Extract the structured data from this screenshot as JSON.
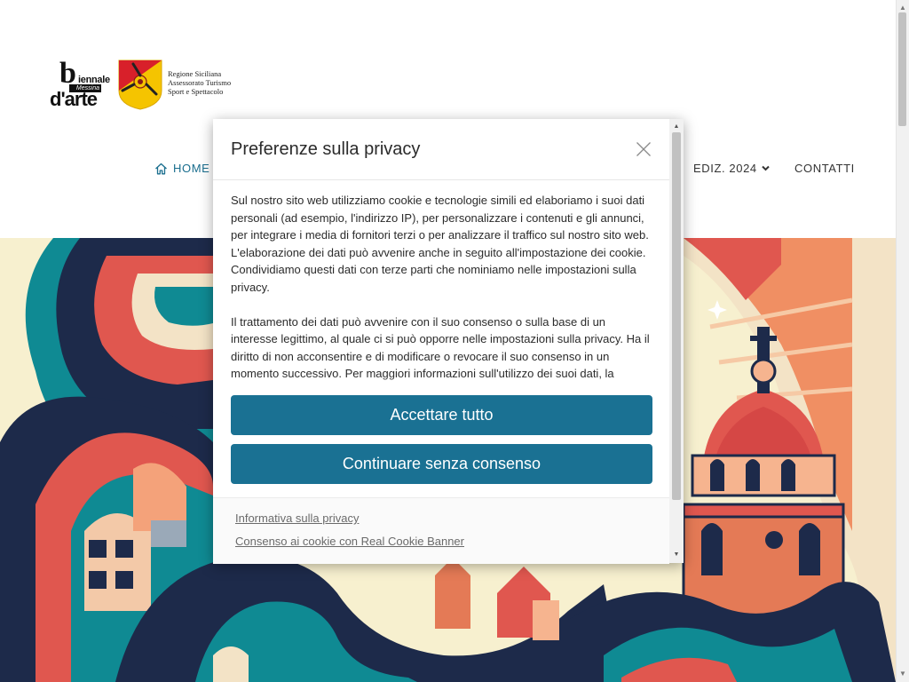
{
  "header": {
    "logo_biennale": {
      "letter": "b",
      "ien": "iennale",
      "strip": "Messina",
      "darte": "d'arte"
    },
    "logo_region": {
      "lines": [
        "Regione Siciliana",
        "Assessorato Turismo",
        "Sport e Spettacolo"
      ]
    },
    "nav": {
      "home": "HOME",
      "ediz": "EDIZ. 2024",
      "contatti": "CONTATTI"
    }
  },
  "modal": {
    "title": "Preferenze sulla privacy",
    "paragraphs": [
      "Sul nostro sito web utilizziamo cookie e tecnologie simili ed elaboriamo i suoi dati personali (ad esempio, l'indirizzo IP), per personalizzare i contenuti e gli annunci, per integrare i media di fornitori terzi o per analizzare il traffico sul nostro sito web. L'elaborazione dei dati può avvenire anche in seguito all'impostazione dei cookie. Condividiamo questi dati con terze parti che nominiamo nelle impostazioni sulla privacy.",
      "Il trattamento dei dati può avvenire con il suo consenso o sulla base di un interesse legittimo, al quale ci si può opporre nelle impostazioni sulla privacy. Ha il diritto di non acconsentire e di modificare o revocare il suo consenso in un momento successivo. Per maggiori informazioni sull'utilizzo dei suoi dati, la"
    ],
    "accept_label": "Accettare tutto",
    "continue_label": "Continuare senza consenso",
    "footer_links": [
      "Informativa sulla privacy",
      "Consenso ai cookie con Real Cookie Banner"
    ]
  },
  "colors": {
    "accent": "#1a7193",
    "nav_active": "#1a6e8e",
    "hero_background": "#f7f0cf"
  },
  "icons": [
    "home-icon",
    "chevron-down-icon",
    "close-icon"
  ]
}
